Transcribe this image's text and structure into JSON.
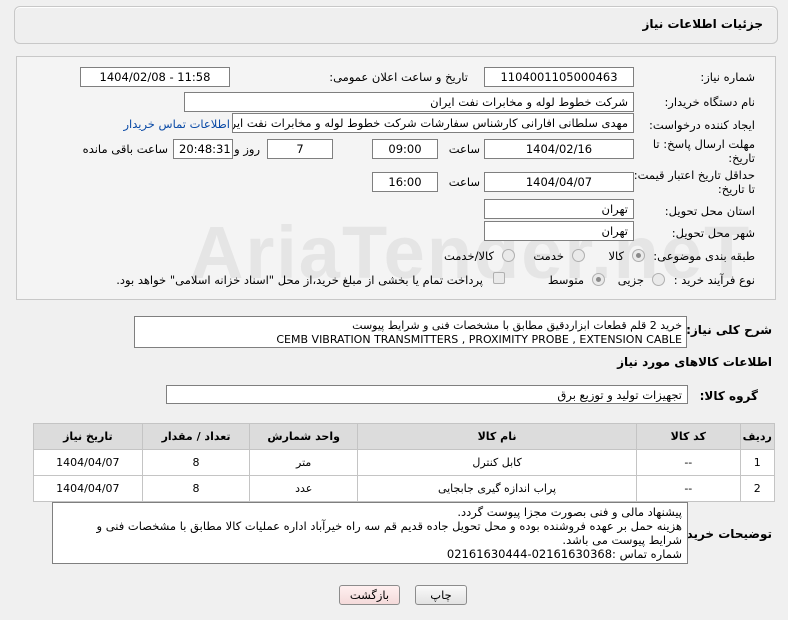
{
  "header": {
    "title": "جزئیات اطلاعات نیاز"
  },
  "watermark": "AriaTender.neT",
  "form": {
    "need_number_label": "شماره نیاز:",
    "need_number": "1104001105000463",
    "announce_label": "تاریخ و ساعت اعلان عمومی:",
    "announce_value": "1404/02/08 - 11:58",
    "buyer_org_label": "نام دستگاه خریدار:",
    "buyer_org": "شرکت خطوط لوله و مخابرات نفت ایران",
    "creator_label": "ایجاد کننده درخواست:",
    "creator": "مهدی سلطانی افارانی کارشناس سفارشات  شرکت خطوط لوله و مخابرات نفت ایران",
    "contact_link": "اطلاعات تماس خریدار",
    "reply_deadline_label_1": "مهلت ارسال پاسخ: تا",
    "reply_deadline_label_2": "تاریخ:",
    "reply_date": "1404/02/16",
    "time_label": "ساعت",
    "reply_time": "09:00",
    "days_value": "7",
    "days_label": "روز و",
    "remaining_time": "20:48:31",
    "remaining_label": "ساعت باقی مانده",
    "price_deadline_label_1": "حداقل تاریخ اعتبار قیمت:",
    "price_deadline_label_2": "تا تاریخ:",
    "price_date": "1404/04/07",
    "price_time": "16:00",
    "province_label": "استان محل تحویل:",
    "province": "تهران",
    "city_label": "شهر محل تحویل:",
    "city": "تهران",
    "category_label": "طبقه بندی موضوعی:",
    "category_options": [
      "کالا",
      "خدمت",
      "کالا/خدمت"
    ],
    "category_selected": "کالا",
    "process_label": "نوع فرآیند خرید :",
    "process_options": [
      "جزیی",
      "متوسط"
    ],
    "process_selected": "متوسط",
    "payment_note": "پرداخت تمام یا بخشی از مبلغ خرید،از محل \"اسناد خزانه اسلامی\" خواهد بود."
  },
  "description": {
    "label": "شرح کلی نیاز:",
    "line1": "خرید 2 قلم قطعات ابزاردقیق مطابق با  مشخصات فنی و شرایط پیوست",
    "line2": "CEMB VIBRATION TRANSMITTERS , PROXIMITY PROBE , EXTENSION CABLE"
  },
  "goods_info": {
    "title": "اطلاعات کالاهای مورد نیاز",
    "group_label": "گروه کالا:",
    "group_value": "تجهیزات تولید و توزیع برق"
  },
  "table": {
    "headers": [
      "ردیف",
      "کد کالا",
      "نام کالا",
      "واحد شمارش",
      "تعداد / مقدار",
      "تاریخ نیاز"
    ],
    "rows": [
      [
        "1",
        "--",
        "کابل کنترل",
        "متر",
        "8",
        "1404/04/07"
      ],
      [
        "2",
        "--",
        "پراب اندازه گیری جابجایی",
        "عدد",
        "8",
        "1404/04/07"
      ]
    ]
  },
  "buyer_notes": {
    "label": "توضیحات خریدار:",
    "line1": "پیشنهاد  مالی  و فنی بصورت مجزا پیوست گردد.",
    "line2": "هزینه حمل بر عهده فروشنده بوده و محل تحویل جاده قدیم قم سه راه خیرآباد اداره عملیات کالا مطابق با مشخصات فنی و",
    "line3": "شرایط پیوست می باشد.",
    "line4": "شماره تماس :02161630368-02161630444"
  },
  "buttons": {
    "print": "چاپ",
    "back": "بازگشت"
  }
}
